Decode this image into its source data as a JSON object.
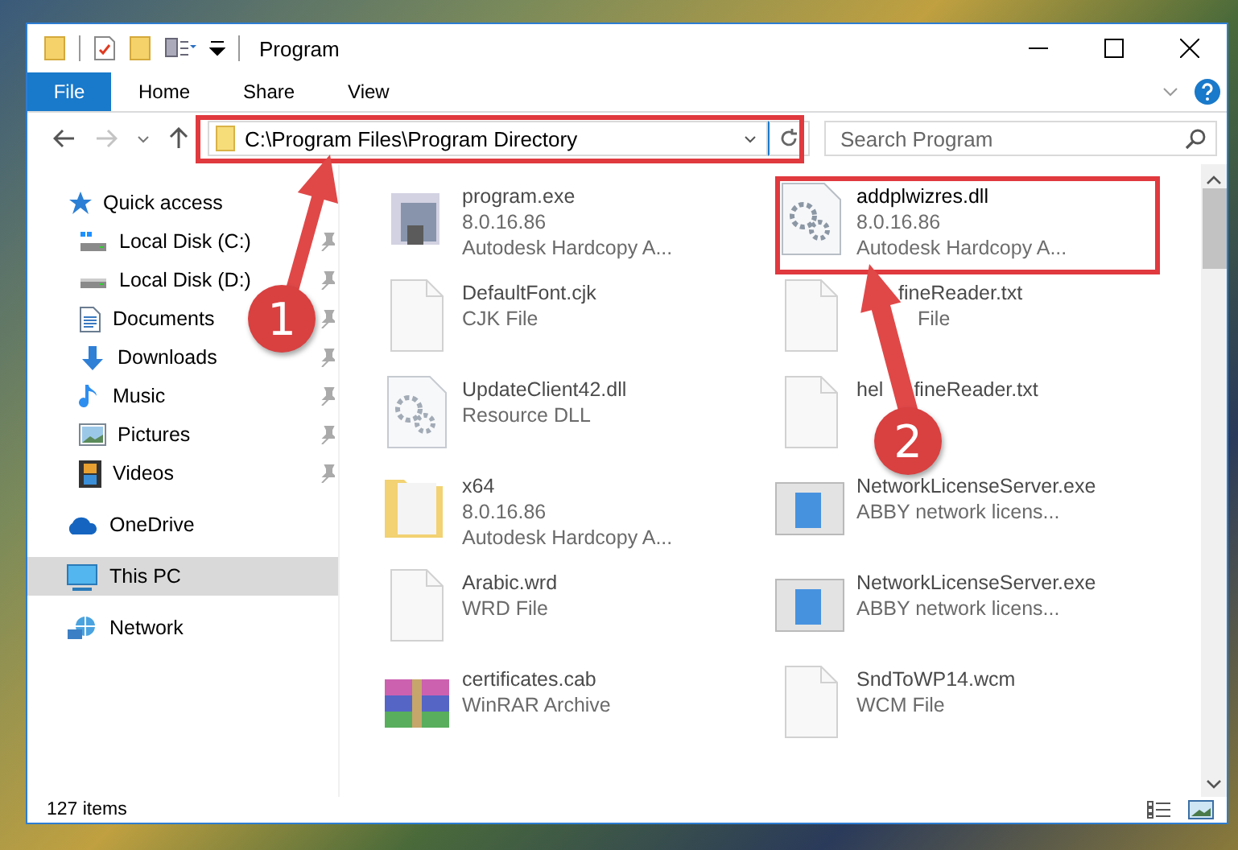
{
  "window": {
    "title": "Program"
  },
  "ribbon_tabs": [
    {
      "label": "File",
      "kind": "file-menu"
    },
    {
      "label": "Home",
      "kind": "tab"
    },
    {
      "label": "Share",
      "kind": "tab"
    },
    {
      "label": "View",
      "kind": "tab"
    }
  ],
  "address_bar": {
    "path": "C:\\Program Files\\Program Directory"
  },
  "search": {
    "placeholder": "Search Program"
  },
  "nav_pane": [
    {
      "label": "Quick access",
      "selected": false,
      "children": [
        {
          "label": "Local Disk (C:)",
          "selected": false
        },
        {
          "label": "Local Disk (D:)",
          "selected": false
        },
        {
          "label": "Documents",
          "selected": false
        },
        {
          "label": "Downloads",
          "selected": false
        },
        {
          "label": "Music",
          "selected": false
        },
        {
          "label": "Pictures",
          "selected": false
        },
        {
          "label": "Videos",
          "selected": false
        }
      ]
    },
    {
      "label": "OneDrive",
      "selected": false
    },
    {
      "label": "This PC",
      "selected": true
    },
    {
      "label": "Network",
      "selected": false
    }
  ],
  "files": [
    {
      "name": "program.exe",
      "details": [
        "8.0.16.86",
        "Autodesk Hardcopy A..."
      ],
      "blurred": true
    },
    {
      "name": "addplwizres.dll",
      "details": [
        "8.0.16.86",
        "Autodesk Hardcopy A..."
      ],
      "blurred": false
    },
    {
      "name": "DefaultFont.cjk",
      "details": [
        "CJK File"
      ],
      "blurred": true
    },
    {
      "name_parts": [
        "fineReader.txt"
      ],
      "detail_parts": [
        "File"
      ],
      "blurred": true
    },
    {
      "name": "UpdateClient42.dll",
      "details": [
        "Resource DLL"
      ],
      "blurred": true
    },
    {
      "name_parts": [
        "hel",
        "fineReader.txt"
      ],
      "blurred": true
    },
    {
      "name": "x64",
      "details": [
        "8.0.16.86",
        "Autodesk Hardcopy A..."
      ],
      "blurred": true
    },
    {
      "name": "NetworkLicenseServer.exe",
      "details": [
        "ABBY network licens..."
      ],
      "blurred": true
    },
    {
      "name": "Arabic.wrd",
      "details": [
        "WRD File"
      ],
      "blurred": true
    },
    {
      "name": "NetworkLicenseServer.exe",
      "details": [
        "ABBY network licens..."
      ],
      "blurred": true
    },
    {
      "name": "certificates.cab",
      "details": [
        "WinRAR Archive"
      ],
      "blurred": true
    },
    {
      "name": "SndToWP14.wcm",
      "details": [
        "WCM File"
      ],
      "blurred": true
    }
  ],
  "status_bar": {
    "item_count": "127 items"
  },
  "annotations": [
    {
      "number": "1"
    },
    {
      "number": "2"
    }
  ]
}
